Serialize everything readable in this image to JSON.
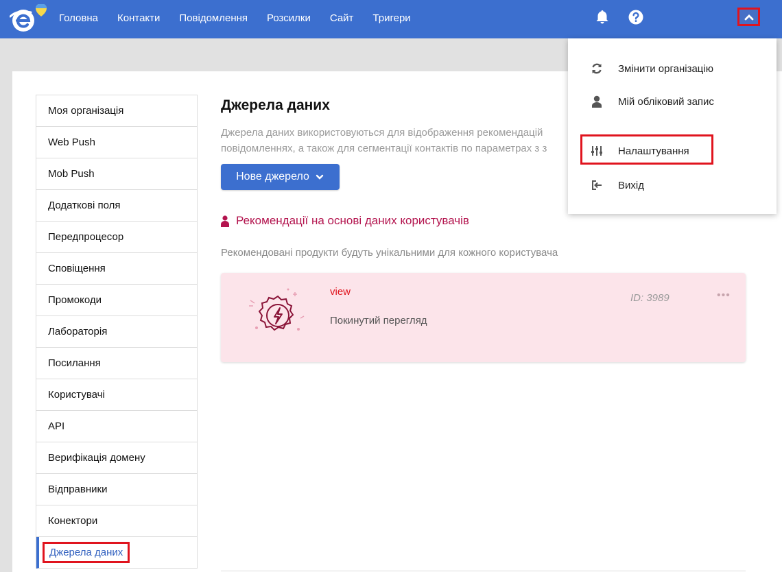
{
  "nav": {
    "items": [
      "Головна",
      "Контакти",
      "Повідомлення",
      "Розсилки",
      "Сайт",
      "Тригери"
    ],
    "icons": {
      "logo": "esputnik-logo-icon",
      "bell": "bell-icon",
      "help": "question-circle-icon",
      "chevron": "chevron-up-icon"
    }
  },
  "sidebar": {
    "items": [
      {
        "label": "Моя організація"
      },
      {
        "label": "Web Push"
      },
      {
        "label": "Mob Push"
      },
      {
        "label": "Додаткові поля"
      },
      {
        "label": "Передпроцесор"
      },
      {
        "label": "Сповіщення"
      },
      {
        "label": "Промокоди"
      },
      {
        "label": "Лабораторія"
      },
      {
        "label": "Посилання"
      },
      {
        "label": "Користувачі"
      },
      {
        "label": "API"
      },
      {
        "label": "Верифікація домену"
      },
      {
        "label": "Відправники"
      },
      {
        "label": "Конектори"
      },
      {
        "label": "Джерела даних"
      }
    ],
    "active_label": "Джерела даних"
  },
  "main": {
    "title": "Джерела даних",
    "description": "Джерела даних використовуються для відображення рекомендацій повідомленнях, а також для сегментації контактів по параметрах з з",
    "new_button": "Нове джерело",
    "section_title": "Рекомендації на основі даних користувачів",
    "section_subtitle": "Рекомендовані продукти будуть унікальними для кожного користувача",
    "card": {
      "name": "view",
      "type": "Покинутий перегляд",
      "id_label": "ID: 3989",
      "menu": "•••"
    }
  },
  "dropdown": {
    "items": [
      {
        "label": "Змінити організацію",
        "icon": "sync-icon"
      },
      {
        "label": "Мій обліковий запис",
        "icon": "user-icon"
      },
      {
        "label": "Налаштування",
        "icon": "sliders-icon"
      },
      {
        "label": "Вихід",
        "icon": "sign-out-icon"
      }
    ]
  },
  "colors": {
    "brand_blue": "#3c6fcf",
    "highlight_red": "#e0141e",
    "section_red": "#b3144e",
    "card_bg": "#fce4ea"
  }
}
